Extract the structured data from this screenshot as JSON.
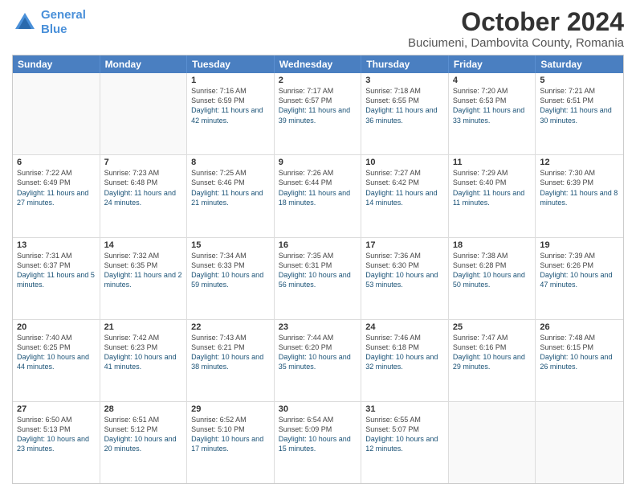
{
  "header": {
    "logo_line1": "General",
    "logo_line2": "Blue",
    "main_title": "October 2024",
    "subtitle": "Buciumeni, Dambovita County, Romania"
  },
  "days_of_week": [
    "Sunday",
    "Monday",
    "Tuesday",
    "Wednesday",
    "Thursday",
    "Friday",
    "Saturday"
  ],
  "weeks": [
    [
      {
        "day": "",
        "info": ""
      },
      {
        "day": "",
        "info": ""
      },
      {
        "day": "1",
        "sunrise": "Sunrise: 7:16 AM",
        "sunset": "Sunset: 6:59 PM",
        "daylight": "Daylight: 11 hours and 42 minutes."
      },
      {
        "day": "2",
        "sunrise": "Sunrise: 7:17 AM",
        "sunset": "Sunset: 6:57 PM",
        "daylight": "Daylight: 11 hours and 39 minutes."
      },
      {
        "day": "3",
        "sunrise": "Sunrise: 7:18 AM",
        "sunset": "Sunset: 6:55 PM",
        "daylight": "Daylight: 11 hours and 36 minutes."
      },
      {
        "day": "4",
        "sunrise": "Sunrise: 7:20 AM",
        "sunset": "Sunset: 6:53 PM",
        "daylight": "Daylight: 11 hours and 33 minutes."
      },
      {
        "day": "5",
        "sunrise": "Sunrise: 7:21 AM",
        "sunset": "Sunset: 6:51 PM",
        "daylight": "Daylight: 11 hours and 30 minutes."
      }
    ],
    [
      {
        "day": "6",
        "sunrise": "Sunrise: 7:22 AM",
        "sunset": "Sunset: 6:49 PM",
        "daylight": "Daylight: 11 hours and 27 minutes."
      },
      {
        "day": "7",
        "sunrise": "Sunrise: 7:23 AM",
        "sunset": "Sunset: 6:48 PM",
        "daylight": "Daylight: 11 hours and 24 minutes."
      },
      {
        "day": "8",
        "sunrise": "Sunrise: 7:25 AM",
        "sunset": "Sunset: 6:46 PM",
        "daylight": "Daylight: 11 hours and 21 minutes."
      },
      {
        "day": "9",
        "sunrise": "Sunrise: 7:26 AM",
        "sunset": "Sunset: 6:44 PM",
        "daylight": "Daylight: 11 hours and 18 minutes."
      },
      {
        "day": "10",
        "sunrise": "Sunrise: 7:27 AM",
        "sunset": "Sunset: 6:42 PM",
        "daylight": "Daylight: 11 hours and 14 minutes."
      },
      {
        "day": "11",
        "sunrise": "Sunrise: 7:29 AM",
        "sunset": "Sunset: 6:40 PM",
        "daylight": "Daylight: 11 hours and 11 minutes."
      },
      {
        "day": "12",
        "sunrise": "Sunrise: 7:30 AM",
        "sunset": "Sunset: 6:39 PM",
        "daylight": "Daylight: 11 hours and 8 minutes."
      }
    ],
    [
      {
        "day": "13",
        "sunrise": "Sunrise: 7:31 AM",
        "sunset": "Sunset: 6:37 PM",
        "daylight": "Daylight: 11 hours and 5 minutes."
      },
      {
        "day": "14",
        "sunrise": "Sunrise: 7:32 AM",
        "sunset": "Sunset: 6:35 PM",
        "daylight": "Daylight: 11 hours and 2 minutes."
      },
      {
        "day": "15",
        "sunrise": "Sunrise: 7:34 AM",
        "sunset": "Sunset: 6:33 PM",
        "daylight": "Daylight: 10 hours and 59 minutes."
      },
      {
        "day": "16",
        "sunrise": "Sunrise: 7:35 AM",
        "sunset": "Sunset: 6:31 PM",
        "daylight": "Daylight: 10 hours and 56 minutes."
      },
      {
        "day": "17",
        "sunrise": "Sunrise: 7:36 AM",
        "sunset": "Sunset: 6:30 PM",
        "daylight": "Daylight: 10 hours and 53 minutes."
      },
      {
        "day": "18",
        "sunrise": "Sunrise: 7:38 AM",
        "sunset": "Sunset: 6:28 PM",
        "daylight": "Daylight: 10 hours and 50 minutes."
      },
      {
        "day": "19",
        "sunrise": "Sunrise: 7:39 AM",
        "sunset": "Sunset: 6:26 PM",
        "daylight": "Daylight: 10 hours and 47 minutes."
      }
    ],
    [
      {
        "day": "20",
        "sunrise": "Sunrise: 7:40 AM",
        "sunset": "Sunset: 6:25 PM",
        "daylight": "Daylight: 10 hours and 44 minutes."
      },
      {
        "day": "21",
        "sunrise": "Sunrise: 7:42 AM",
        "sunset": "Sunset: 6:23 PM",
        "daylight": "Daylight: 10 hours and 41 minutes."
      },
      {
        "day": "22",
        "sunrise": "Sunrise: 7:43 AM",
        "sunset": "Sunset: 6:21 PM",
        "daylight": "Daylight: 10 hours and 38 minutes."
      },
      {
        "day": "23",
        "sunrise": "Sunrise: 7:44 AM",
        "sunset": "Sunset: 6:20 PM",
        "daylight": "Daylight: 10 hours and 35 minutes."
      },
      {
        "day": "24",
        "sunrise": "Sunrise: 7:46 AM",
        "sunset": "Sunset: 6:18 PM",
        "daylight": "Daylight: 10 hours and 32 minutes."
      },
      {
        "day": "25",
        "sunrise": "Sunrise: 7:47 AM",
        "sunset": "Sunset: 6:16 PM",
        "daylight": "Daylight: 10 hours and 29 minutes."
      },
      {
        "day": "26",
        "sunrise": "Sunrise: 7:48 AM",
        "sunset": "Sunset: 6:15 PM",
        "daylight": "Daylight: 10 hours and 26 minutes."
      }
    ],
    [
      {
        "day": "27",
        "sunrise": "Sunrise: 6:50 AM",
        "sunset": "Sunset: 5:13 PM",
        "daylight": "Daylight: 10 hours and 23 minutes."
      },
      {
        "day": "28",
        "sunrise": "Sunrise: 6:51 AM",
        "sunset": "Sunset: 5:12 PM",
        "daylight": "Daylight: 10 hours and 20 minutes."
      },
      {
        "day": "29",
        "sunrise": "Sunrise: 6:52 AM",
        "sunset": "Sunset: 5:10 PM",
        "daylight": "Daylight: 10 hours and 17 minutes."
      },
      {
        "day": "30",
        "sunrise": "Sunrise: 6:54 AM",
        "sunset": "Sunset: 5:09 PM",
        "daylight": "Daylight: 10 hours and 15 minutes."
      },
      {
        "day": "31",
        "sunrise": "Sunrise: 6:55 AM",
        "sunset": "Sunset: 5:07 PM",
        "daylight": "Daylight: 10 hours and 12 minutes."
      },
      {
        "day": "",
        "info": ""
      },
      {
        "day": "",
        "info": ""
      }
    ]
  ]
}
